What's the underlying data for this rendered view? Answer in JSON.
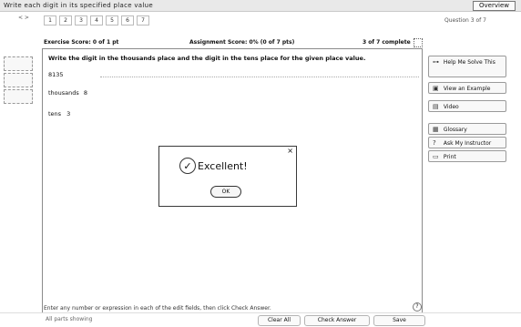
{
  "window": {
    "title": "Write each digit in its specified place value",
    "overview_button": "Overview"
  },
  "navigation": {
    "prev_next_label": "< >",
    "question_tabs": [
      "1",
      "2",
      "3",
      "4",
      "5",
      "6",
      "7"
    ],
    "status_text": "Question 3 of 7"
  },
  "scores": {
    "exercise_score": "Exercise Score: 0 of 1 pt",
    "assignment_score": "Assignment Score: 0% (0 of 7 pts)",
    "progress": "3 of 7 complete"
  },
  "question": {
    "prompt": "Write the digit in the thousands place and the digit in the tens place for the given place value.",
    "value": "8135",
    "thousands_label": "thousands",
    "thousands_answer": "8",
    "tens_label": "tens",
    "tens_answer": "3"
  },
  "dialog": {
    "message": "Excellent!",
    "ok_label": "OK"
  },
  "help_panel": {
    "items": [
      {
        "label": "Help Me Solve This",
        "icon": "bulb-icon"
      },
      {
        "label": "View an Example",
        "icon": "book-icon"
      },
      {
        "label": "Video",
        "icon": "video-icon"
      },
      {
        "label": "Glossary",
        "icon": "glossary-icon"
      },
      {
        "label": "Ask My Instructor",
        "icon": "question-icon"
      },
      {
        "label": "Print",
        "icon": "print-icon"
      }
    ]
  },
  "footer": {
    "instructions": "Enter any number or expression in each of the edit fields, then click Check Answer.",
    "all_parts_text": "All parts showing",
    "clear_all": "Clear All",
    "check_answer": "Check Answer",
    "save": "Save"
  },
  "colors": {
    "accent": "#2b2b2b",
    "panel_border": "#8b8b8b"
  }
}
